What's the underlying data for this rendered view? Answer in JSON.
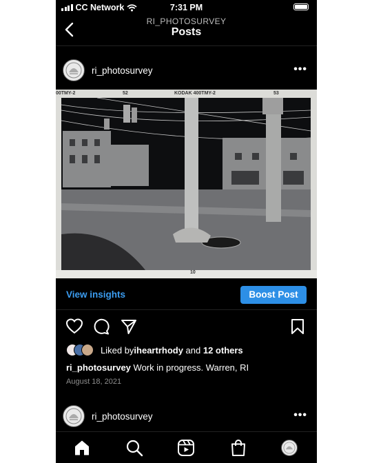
{
  "status_bar": {
    "carrier": "CC Network",
    "time": "7:31 PM"
  },
  "nav": {
    "subtitle": "RI_PHOTOSURVEY",
    "title": "Posts"
  },
  "post": {
    "username": "ri_photosurvey",
    "more": "•••",
    "photo_edge_labels": {
      "left": "00TMY-2",
      "frame1": "52",
      "brand": "KODAK  400TMY-2",
      "frame2": "53",
      "bottom": "10"
    },
    "view_insights": "View insights",
    "boost_post": "Boost Post",
    "likes": {
      "prefix": "Liked by ",
      "user": "iheartrhody",
      "middle": " and ",
      "others": "12 others"
    },
    "caption": {
      "username": "ri_photosurvey",
      "text": " Work in progress. Warren, RI"
    },
    "date": "August 18, 2021"
  },
  "post2": {
    "username": "ri_photosurvey",
    "more": "•••"
  },
  "colors": {
    "accent": "#2d8fe6",
    "link": "#3b9cf0",
    "background": "#000000"
  },
  "icons": [
    "back-chevron-icon",
    "heart-icon",
    "comment-icon",
    "share-icon",
    "bookmark-icon",
    "home-icon",
    "search-icon",
    "reels-icon",
    "shop-icon",
    "profile-icon"
  ]
}
